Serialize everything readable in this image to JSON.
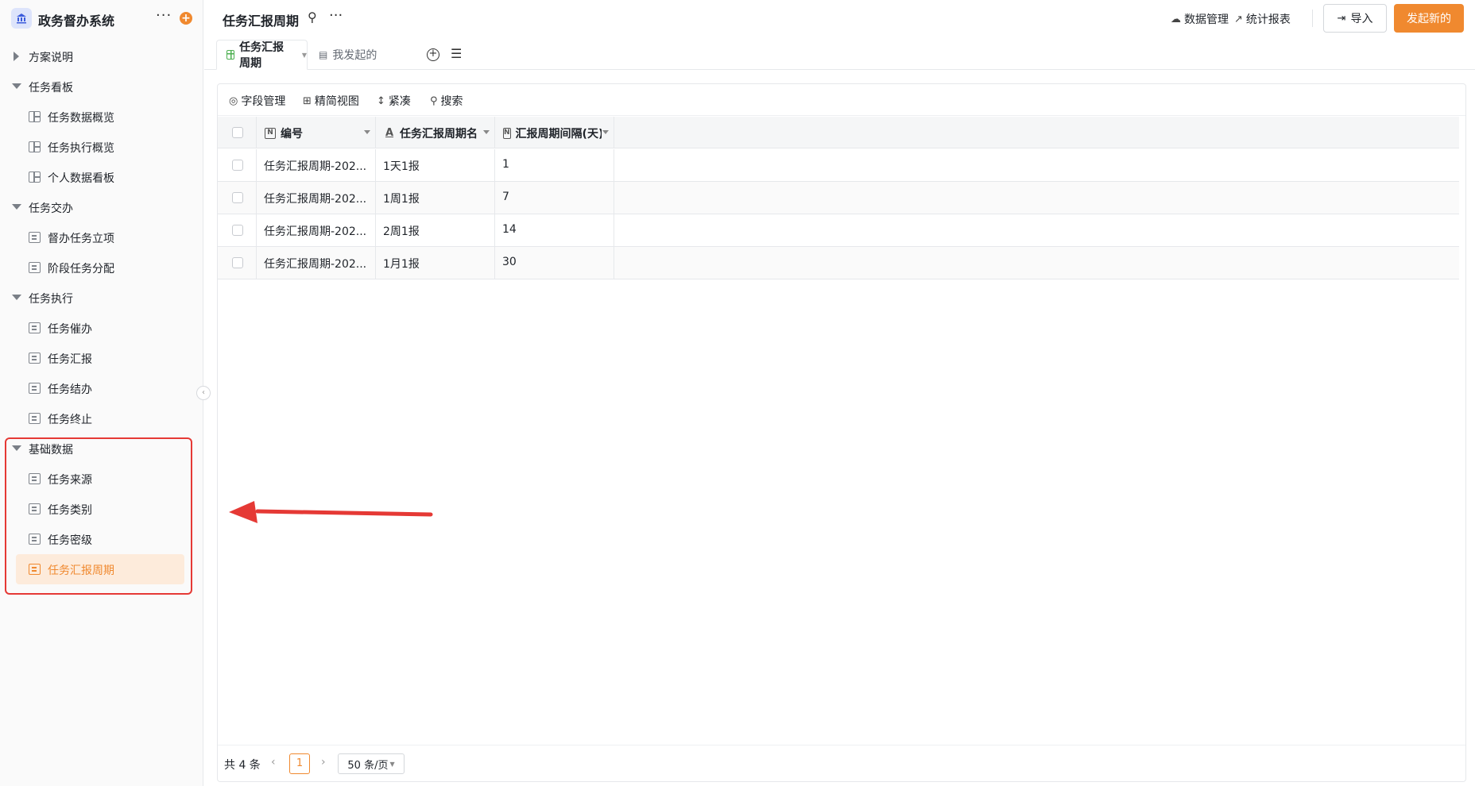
{
  "app": {
    "title": "政务督办系统",
    "more_icon": "more-icon",
    "add_icon": "add-icon"
  },
  "sidebar": {
    "groups": [
      {
        "label": "方案说明",
        "expanded": false,
        "items": []
      },
      {
        "label": "任务看板",
        "expanded": true,
        "items": [
          {
            "label": "任务数据概览",
            "icon": "board-icon"
          },
          {
            "label": "任务执行概览",
            "icon": "board-icon"
          },
          {
            "label": "个人数据看板",
            "icon": "board-icon"
          }
        ]
      },
      {
        "label": "任务交办",
        "expanded": true,
        "items": [
          {
            "label": "督办任务立项",
            "icon": "form-icon"
          },
          {
            "label": "阶段任务分配",
            "icon": "form-icon"
          }
        ]
      },
      {
        "label": "任务执行",
        "expanded": true,
        "items": [
          {
            "label": "任务催办",
            "icon": "form-icon"
          },
          {
            "label": "任务汇报",
            "icon": "form-icon"
          },
          {
            "label": "任务结办",
            "icon": "form-icon"
          },
          {
            "label": "任务终止",
            "icon": "form-icon"
          }
        ]
      },
      {
        "label": "基础数据",
        "expanded": true,
        "items": [
          {
            "label": "任务来源",
            "icon": "form-icon"
          },
          {
            "label": "任务类别",
            "icon": "form-icon"
          },
          {
            "label": "任务密级",
            "icon": "form-icon"
          },
          {
            "label": "任务汇报周期",
            "icon": "form-icon",
            "active": true
          }
        ]
      }
    ]
  },
  "header": {
    "title": "任务汇报周期",
    "data_manage": "数据管理",
    "report": "统计报表",
    "import": "导入",
    "primary": "发起新的"
  },
  "tabs": [
    {
      "label": "任务汇报周期",
      "active": true
    },
    {
      "label": "我发起的",
      "active": false
    }
  ],
  "toolbar": {
    "fields": "字段管理",
    "simple_view": "精简视图",
    "compact": "紧凑",
    "search": "搜索"
  },
  "table": {
    "columns": [
      "编号",
      "任务汇报周期名",
      "汇报周期间隔(天)"
    ],
    "rows": [
      [
        "任务汇报周期-202...",
        "1天1报",
        "1"
      ],
      [
        "任务汇报周期-202...",
        "1周1报",
        "7"
      ],
      [
        "任务汇报周期-202...",
        "2周1报",
        "14"
      ],
      [
        "任务汇报周期-202...",
        "1月1报",
        "30"
      ]
    ]
  },
  "pagination": {
    "total": "共 4 条",
    "current": "1",
    "page_size": "50 条/页"
  },
  "colors": {
    "accent": "#f0892f",
    "highlight": "#e53935"
  }
}
